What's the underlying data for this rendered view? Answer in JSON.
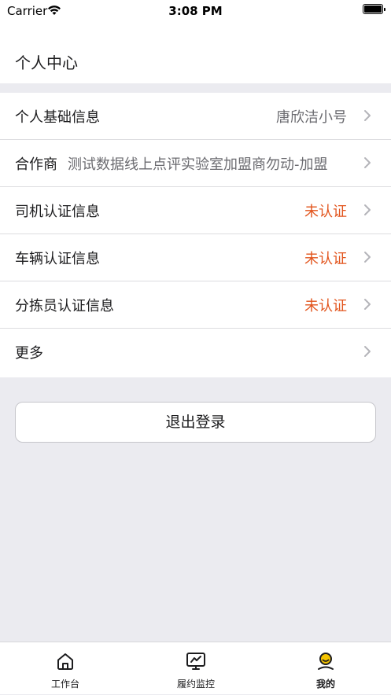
{
  "status_bar": {
    "carrier": "Carrier",
    "time": "3:08 PM"
  },
  "header": {
    "title": "个人中心"
  },
  "menu": [
    {
      "label": "个人基础信息",
      "value": "唐欣洁小号",
      "status": "normal"
    },
    {
      "label": "合作商",
      "value": "测试数据线上点评实验室加盟商勿动-加盟",
      "status": "normal"
    },
    {
      "label": "司机认证信息",
      "value": "未认证",
      "status": "warn"
    },
    {
      "label": "车辆认证信息",
      "value": "未认证",
      "status": "warn"
    },
    {
      "label": "分拣员认证信息",
      "value": "未认证",
      "status": "warn"
    },
    {
      "label": "更多",
      "value": "",
      "status": "normal"
    }
  ],
  "logout_label": "退出登录",
  "tabs": [
    {
      "label": "工作台",
      "icon": "home-icon",
      "active": false
    },
    {
      "label": "履约监控",
      "icon": "monitor-icon",
      "active": false
    },
    {
      "label": "我的",
      "icon": "user-icon",
      "active": true
    }
  ],
  "colors": {
    "warn": "#e2541c",
    "accent": "#f5c400",
    "background": "#ebebf0"
  }
}
